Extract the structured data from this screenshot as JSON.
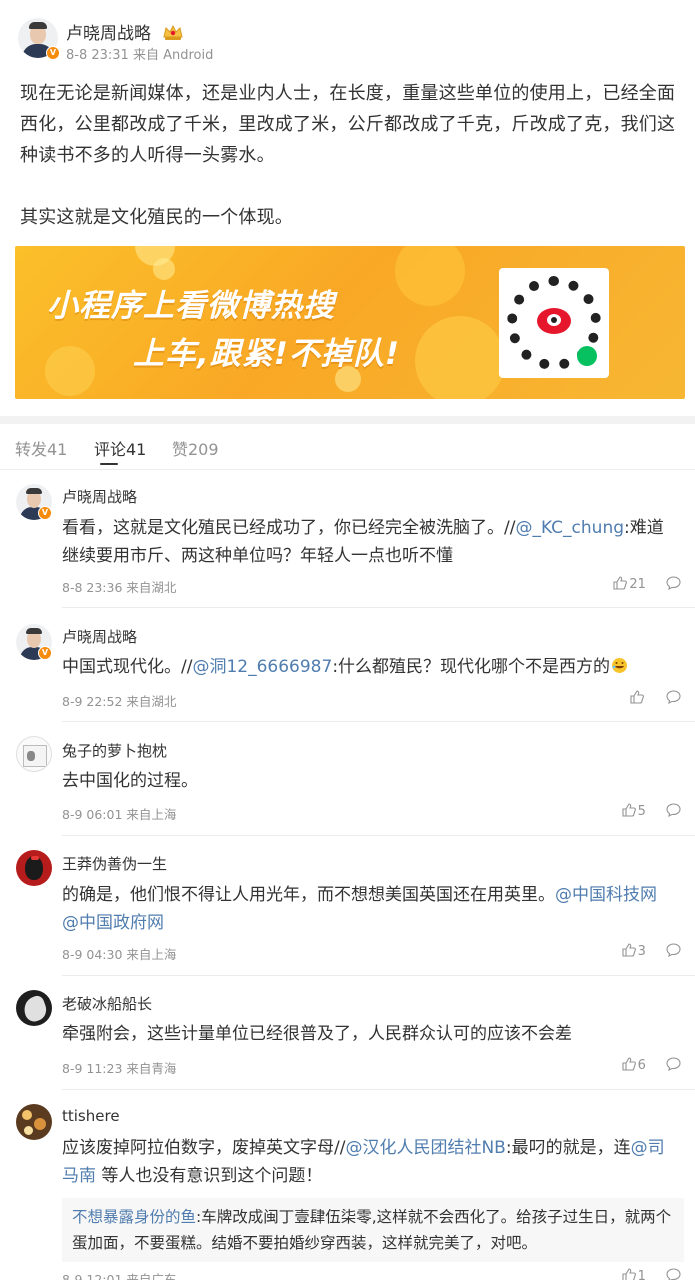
{
  "post": {
    "author": "卢晓周战略",
    "meta": "8-8 23:31 来自 Android",
    "paragraphs": [
      "现在无论是新闻媒体，还是业内人士，在长度，重量这些单位的使用上，已经全面西化，公里都改成了千米，里改成了米，公斤都改成了千克，斤改成了克，我们这种读书不多的人听得一头雾水。",
      "其实这就是文化殖民的一个体现。"
    ]
  },
  "banner": {
    "line1": "小程序上看微博热搜",
    "line2": "上车,跟紧!不掉队!"
  },
  "tabs": {
    "reposts": "转发41",
    "comments": "评论41",
    "likes": "赞209"
  },
  "comments": [
    {
      "author": "卢晓周战略",
      "text_pre": "看看，这就是文化殖民已经成功了，你已经完全被洗脑了。//",
      "mention": "@_KC_chung",
      "text_post": ":难道继续要用市斤、两这种单位吗？年轻人一点也听不懂",
      "meta": "8-8 23:36 来自湖北",
      "likes": "21"
    },
    {
      "author": "卢晓周战略",
      "text_pre": "中国式现代化。//",
      "mention": "@洞12_6666987",
      "text_post": ":什么都殖民？现代化哪个不是西方的",
      "meta": "8-9 22:52 来自湖北",
      "likes": ""
    },
    {
      "author": "兔子的萝卜抱枕",
      "text": "去中国化的过程。",
      "meta": "8-9 06:01 来自上海",
      "likes": "5"
    },
    {
      "author": "王莽伪善伪一生",
      "text_pre": "的确是，他们恨不得让人用光年，而不想想美国英国还在用英里。",
      "mention": "@中国科技网",
      "mention2": "@中国政府网",
      "meta": "8-9 04:30 来自上海",
      "likes": "3"
    },
    {
      "author": "老破冰船船长",
      "text": "牵强附会，这些计量单位已经很普及了，人民群众认可的应该不会差",
      "meta": "8-9 11:23 来自青海",
      "likes": "6"
    },
    {
      "author": "ttishere",
      "text_pre": "应该废掉阿拉伯数字，废掉英文字母//",
      "mention": "@汉化人民团结社NB",
      "text_mid": ":最叼的就是，连",
      "mention2": "@司马南",
      "text_post": " 等人也没有意识到这个问题！",
      "reply_author": "不想暴露身份的鱼",
      "reply_text": ":车牌改成闽丁壹肆伍柒零,这样就不会西化了。给孩子过生日，就两个蛋加面，不要蛋糕。结婚不要拍婚纱穿西装，这样就完美了，对吧。",
      "meta": "8-9 12:01 来自广东",
      "likes": "1"
    }
  ],
  "icons": {
    "verified": "verified-v-badge",
    "like": "thumbs-up-icon",
    "comment": "comment-bubble-icon",
    "crown": "member-crown-icon"
  },
  "colors": {
    "link": "#507daf",
    "meta": "#939393",
    "banner": "#f9a825",
    "verified": "#f78b0c"
  }
}
